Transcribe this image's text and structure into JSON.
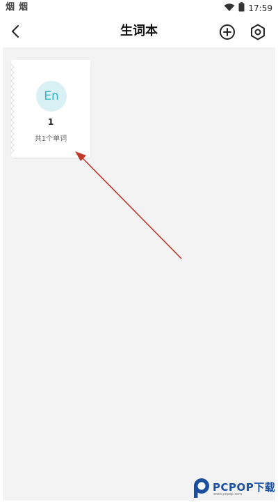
{
  "status_bar": {
    "left_glyphs": [
      "烟",
      "烟"
    ],
    "time": "17:59",
    "icons": [
      "wifi-icon",
      "battery-icon"
    ]
  },
  "header": {
    "title": "生词本",
    "back_icon": "chevron-left-icon",
    "add_icon": "plus-circle-icon",
    "settings_icon": "hexagon-settings-icon"
  },
  "notebooks": [
    {
      "avatar_text": "En",
      "name": "1",
      "word_count": "共1个单词"
    }
  ],
  "colors": {
    "background": "#f3f3f3",
    "avatar_bg": "#d9f0f4",
    "avatar_text": "#38b6c8",
    "annotation_arrow": "#c0392b",
    "watermark": "#1a4fa0"
  },
  "watermark": {
    "text": "PCPOP下载",
    "subtext": "www.pcpop.com"
  }
}
